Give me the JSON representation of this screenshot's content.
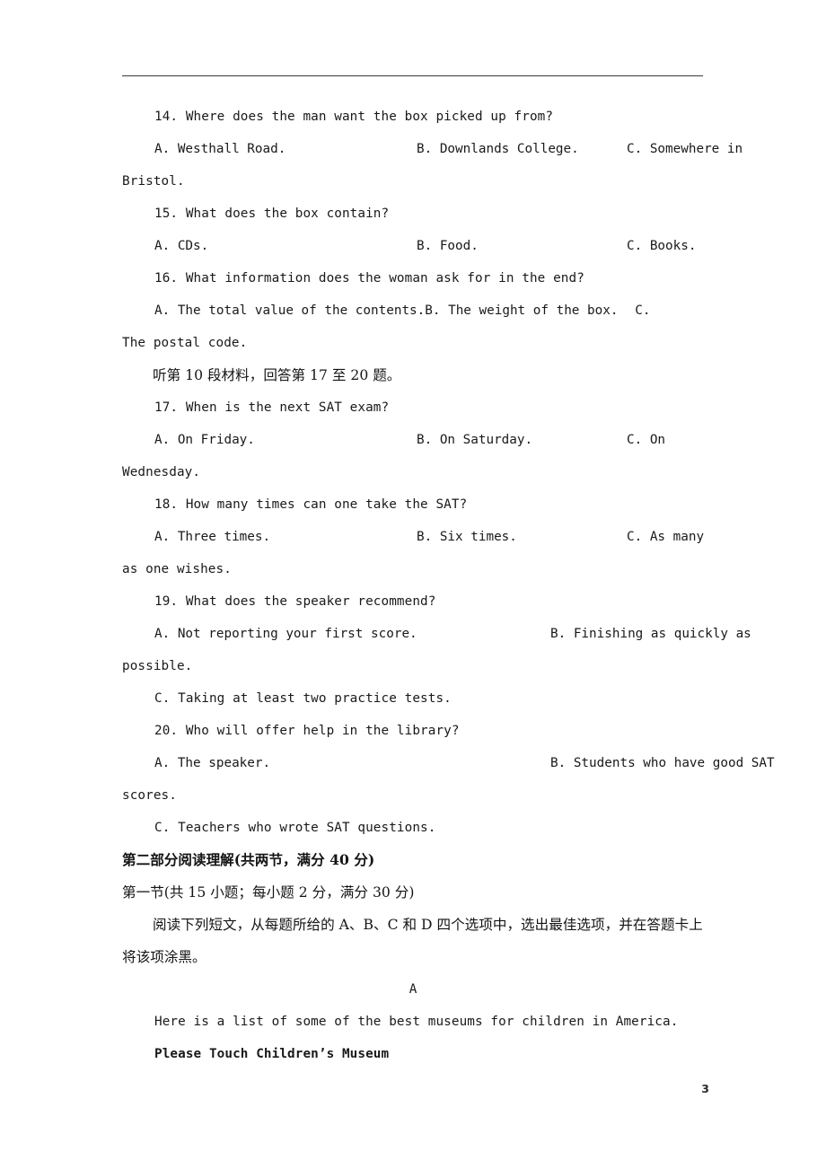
{
  "document": {
    "page_number": "3",
    "header_rule": true
  },
  "listening": {
    "questions": [
      {
        "number": "14.",
        "stem": "14.  Where does the man want the box picked up from?",
        "options": [
          "A. Westhall Road.",
          "B. Downlands College.",
          "C. Somewhere in"
        ],
        "wrap": "Bristol."
      },
      {
        "number": "15.",
        "stem": "15.  What does the box contain?",
        "options": [
          "A.  CDs.",
          "B.  Food.",
          "C.  Books."
        ],
        "wrap": ""
      },
      {
        "number": "16.",
        "stem": "16.  What information does the woman ask for in the end?",
        "options": [
          "A.  The total value of the contents.",
          "B.  The weight of the box.",
          "C."
        ],
        "wrap": "The postal code."
      }
    ],
    "direction_cn": "听第 10 段材料，回答第 17 至 20 题。",
    "questions2": [
      {
        "number": "17.",
        "stem": "17.  When is the next SAT exam?",
        "options": [
          "A.  On Friday.",
          "B.  On Saturday.",
          "C.  On"
        ],
        "wrap": "Wednesday."
      },
      {
        "number": "18.",
        "stem": "18.  How many times can one take the SAT?",
        "options": [
          "A. Three times.",
          "B. Six times.",
          "C. As many"
        ],
        "wrap": "as one wishes."
      },
      {
        "number": "19.",
        "stem": "19.  What does the speaker recommend?",
        "options2": [
          "A.  Not reporting your first score.",
          "B.  Finishing as quickly as"
        ],
        "wrap": "possible.",
        "option_c": "C.  Taking at least two practice tests."
      },
      {
        "number": "20.",
        "stem": "20.  Who will offer help in the library?",
        "options2": [
          "A.  The speaker.",
          "B.  Students who have good SAT"
        ],
        "wrap": "scores.",
        "option_c": "C.  Teachers who wrote SAT questions."
      }
    ]
  },
  "part_two": {
    "heading": "第二部分阅读理解(共两节，满分 40 分)",
    "section_one": "第一节(共 15 小题；每小题 2 分，满分 30 分)",
    "instruction_line1": "阅读下列短文，从每题所给的 A、B、C 和 D 四个选项中，选出最佳选项，并在答题卡上",
    "instruction_line2": "将该项涂黑。",
    "passage_label": "A",
    "passage_intro": "Here is a list of some of the best museums for children in America.",
    "passage_subheading": "Please Touch Children’s Museum"
  }
}
